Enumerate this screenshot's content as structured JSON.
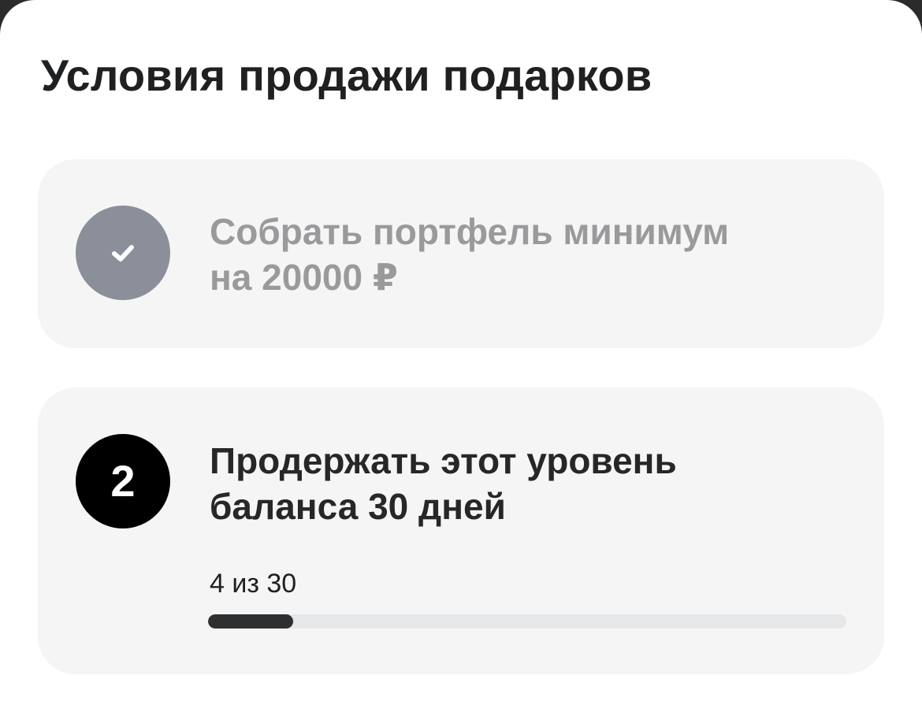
{
  "sheet": {
    "title": "Условия продажи подарков"
  },
  "conditions": [
    {
      "status": "completed",
      "icon": "checkmark-icon",
      "text_line1": "Собрать портфель минимум",
      "text_line2": "на 20000 ₽"
    },
    {
      "status": "active",
      "step_number": "2",
      "text_line1": "Продержать этот уровень",
      "text_line2": "баланса 30 дней",
      "progress": {
        "label": "4 из 30",
        "current": 4,
        "total": 30
      }
    }
  ],
  "colors": {
    "completed_badge": "#8a8f99",
    "active_badge": "#000000",
    "progress_fill": "#2e2f31",
    "progress_track": "#e6e7e9",
    "card_bg": "#f5f5f5"
  }
}
